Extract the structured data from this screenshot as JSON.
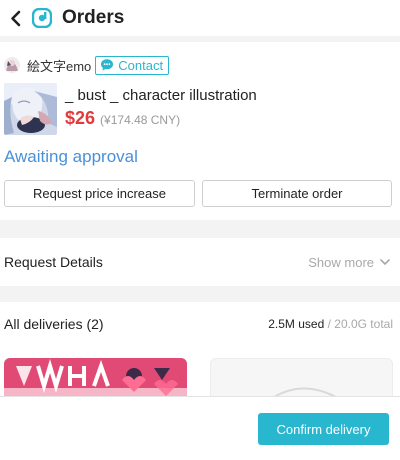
{
  "header": {
    "title": "Orders",
    "back_icon": "chevron-left-icon",
    "logo_icon": "app-logo-icon"
  },
  "order": {
    "seller_name": "絵文字emo",
    "contact_label": "Contact",
    "product_title": "_ bust _ character illustration",
    "price_usd": "$26",
    "price_cny": "(¥174.48 CNY)",
    "status": "Awaiting approval",
    "actions": {
      "increase_label": "Request price increase",
      "terminate_label": "Terminate order"
    }
  },
  "details": {
    "label": "Request Details",
    "show_more": "Show more"
  },
  "deliveries": {
    "title": "All deliveries (2)",
    "used": "2.5M used",
    "separator": "/",
    "total": "20.0G total"
  },
  "footer": {
    "confirm_label": "Confirm delivery"
  },
  "colors": {
    "accent": "#29b6cf",
    "price": "#e23a3a",
    "status": "#4a90d9"
  }
}
